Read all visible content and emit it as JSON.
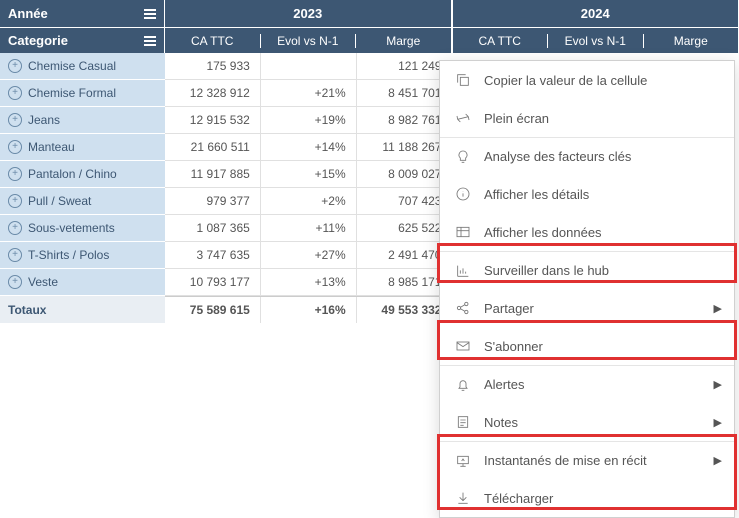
{
  "headers": {
    "annee": "Année",
    "categorie": "Categorie",
    "years": [
      "2023",
      "2024"
    ],
    "subcols": [
      "CA TTC",
      "Evol vs N-1",
      "Marge"
    ]
  },
  "rows": [
    {
      "cat": "Chemise Casual",
      "ca": "175 933",
      "evol": "",
      "marge": "121 249"
    },
    {
      "cat": "Chemise Formal",
      "ca": "12 328 912",
      "evol": "+21%",
      "marge": "8 451 701"
    },
    {
      "cat": "Jeans",
      "ca": "12 915 532",
      "evol": "+19%",
      "marge": "8 982 761"
    },
    {
      "cat": "Manteau",
      "ca": "21 660 511",
      "evol": "+14%",
      "marge": "11 188 267"
    },
    {
      "cat": "Pantalon / Chino",
      "ca": "11 917 885",
      "evol": "+15%",
      "marge": "8 009 027"
    },
    {
      "cat": "Pull / Sweat",
      "ca": "979 377",
      "evol": "+2%",
      "marge": "707 423"
    },
    {
      "cat": "Sous-vetements",
      "ca": "1 087 365",
      "evol": "+11%",
      "marge": "625 522"
    },
    {
      "cat": "T-Shirts / Polos",
      "ca": "3 747 635",
      "evol": "+27%",
      "marge": "2 491 470"
    },
    {
      "cat": "Veste",
      "ca": "10 793 177",
      "evol": "+13%",
      "marge": "8 985 171"
    }
  ],
  "totals": {
    "label": "Totaux",
    "ca": "75 589 615",
    "evol": "+16%",
    "marge": "49 553 332"
  },
  "menu": {
    "copy": "Copier la valeur de la cellule",
    "fullscreen": "Plein écran",
    "analyze": "Analyse des facteurs clés",
    "details": "Afficher les détails",
    "data": "Afficher les données",
    "monitor": "Surveiller dans le hub",
    "share": "Partager",
    "subscribe": "S'abonner",
    "alerts": "Alertes",
    "notes": "Notes",
    "snapshots": "Instantanés de mise en récit",
    "download": "Télécharger"
  }
}
